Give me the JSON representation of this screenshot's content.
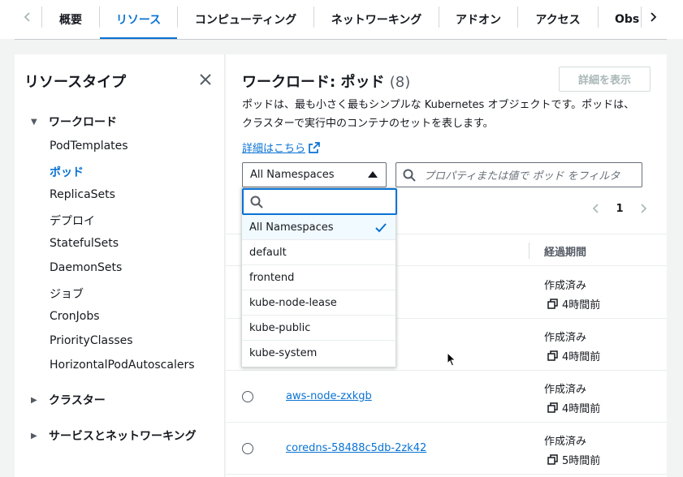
{
  "tabs": [
    {
      "label": "概要",
      "active": false
    },
    {
      "label": "リソース",
      "active": true
    },
    {
      "label": "コンピューティング",
      "active": false
    },
    {
      "label": "ネットワーキング",
      "active": false
    },
    {
      "label": "アドオン",
      "active": false
    },
    {
      "label": "アクセス",
      "active": false
    },
    {
      "label": "Obs",
      "active": false
    }
  ],
  "sidebar": {
    "title": "リソースタイプ",
    "groups": [
      {
        "label": "ワークロード",
        "expanded": true,
        "items": [
          "PodTemplates",
          "ポッド",
          "ReplicaSets",
          "デプロイ",
          "StatefulSets",
          "DaemonSets",
          "ジョブ",
          "CronJobs",
          "PriorityClasses",
          "HorizontalPodAutoscalers"
        ],
        "active_item": "ポッド"
      },
      {
        "label": "クラスター",
        "expanded": false
      },
      {
        "label": "サービスとネットワーキング",
        "expanded": false
      }
    ]
  },
  "main": {
    "title": "ワークロード: ポッド",
    "count": "(8)",
    "details_button": "詳細を表示",
    "description": "ポッドは、最も小さく最もシンプルな Kubernetes オブジェクトです。ポッドは、クラスターで実行中のコンテナのセットを表します。",
    "learn_more": "詳細はこちら",
    "namespace_select": "All Namespaces",
    "filter_placeholder": "プロパティまたは値で ポッド をフィルタ",
    "page": "1",
    "column_age": "経過期間",
    "rows": [
      {
        "name": "",
        "created": "作成済み",
        "age": "4時間前"
      },
      {
        "name": "",
        "created": "作成済み",
        "age": "4時間前"
      },
      {
        "name": "aws-node-zxkgb",
        "created": "作成済み",
        "age": "4時間前"
      },
      {
        "name": "coredns-58488c5db-2zk42",
        "created": "作成済み",
        "age": "5時間前"
      }
    ]
  },
  "dropdown": {
    "options": [
      "All Namespaces",
      "default",
      "frontend",
      "kube-node-lease",
      "kube-public",
      "kube-system"
    ],
    "selected": "All Namespaces"
  },
  "colors": {
    "accent": "#0972d3",
    "text": "#16191f",
    "muted": "#545b64"
  }
}
